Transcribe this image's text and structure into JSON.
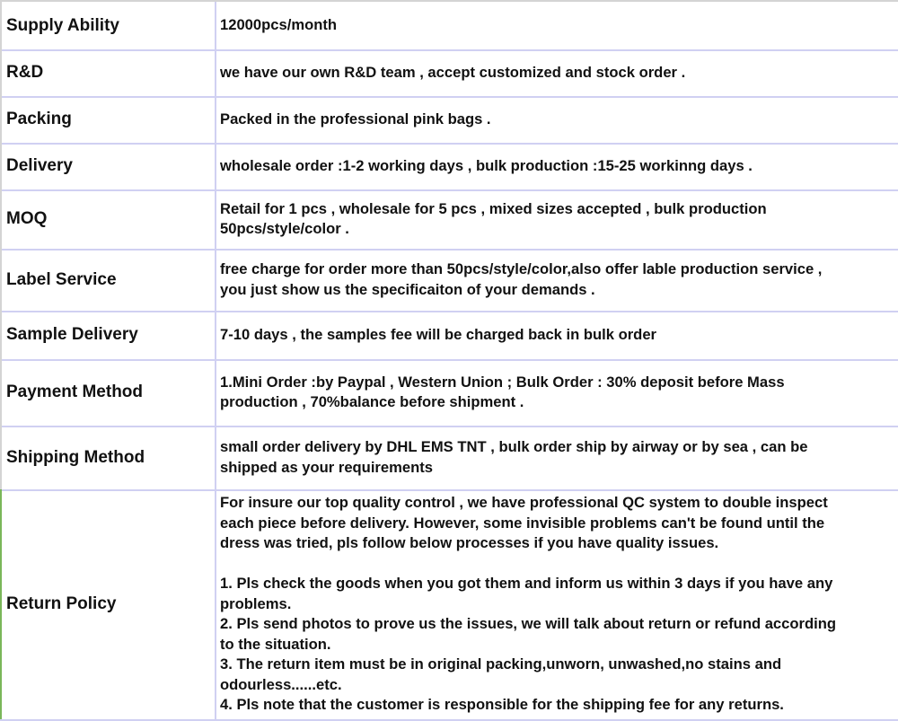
{
  "rows": [
    {
      "label": "Supply Ability",
      "value": "12000pcs/month"
    },
    {
      "label": "R&D",
      "value": "we have our own R&D team , accept customized and stock order ."
    },
    {
      "label": "Packing",
      "value": "Packed in the professional pink bags ."
    },
    {
      "label": "Delivery",
      "value": "wholesale order :1-2 working days , bulk production :15-25 workinng days ."
    },
    {
      "label": "MOQ",
      "value": "Retail for 1 pcs , wholesale for 5 pcs , mixed sizes accepted , bulk production\n50pcs/style/color ."
    },
    {
      "label": "Label Service",
      "value": "free charge for order more than 50pcs/style/color,also offer lable production service ,\nyou just show us the specificaiton of your demands ."
    },
    {
      "label": "Sample Delivery",
      "value": "7-10 days , the samples fee will be charged back in bulk order"
    },
    {
      "label": "Payment Method",
      "value": "1.Mini Order :by Paypal , Western Union ; Bulk Order : 30% deposit before Mass\nproduction , 70%balance before shipment ."
    },
    {
      "label": "Shipping Method",
      "value": "small order delivery by DHL EMS TNT , bulk order ship by airway or by sea , can be\nshipped as your requirements"
    },
    {
      "label": "Return Policy",
      "value": "For insure our top quality control , we have professional QC system to double inspect\neach piece before delivery. However, some invisible problems can't be found until the\ndress was tried, pls follow below processes if you have quality issues.\n\n1. Pls check the goods when you got them and inform us within 3 days if you have any\nproblems.\n2. Pls send photos to prove us the issues, we will talk about return or refund according\nto the situation.\n3. The return item must be in original packing,unworn, unwashed,no stains and\nodourless......etc.\n4. Pls note that the customer is responsible for the shipping fee for any returns."
    }
  ]
}
